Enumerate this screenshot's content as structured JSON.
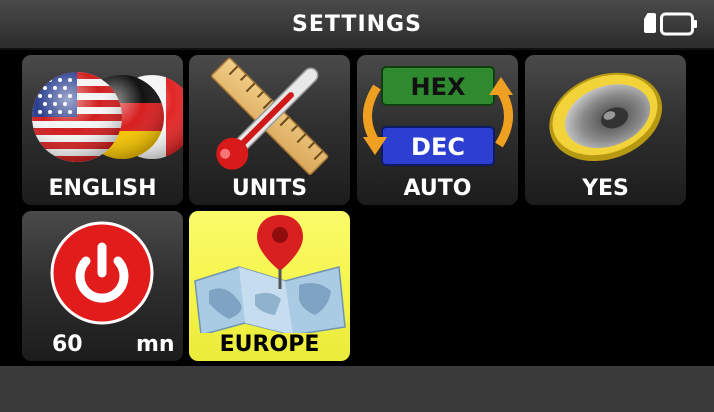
{
  "header": {
    "title": "SETTINGS",
    "status_icons": [
      "sd-card-icon",
      "battery-icon"
    ]
  },
  "tiles": [
    {
      "name": "language",
      "label": "ENGLISH",
      "icon": "flags-icon"
    },
    {
      "name": "units",
      "label": "UNITS",
      "icon": "ruler-thermometer-icon"
    },
    {
      "name": "hex-dec",
      "label": "AUTO",
      "icon": "hex-dec-icon",
      "icon_text": [
        "HEX",
        "DEC"
      ]
    },
    {
      "name": "sound",
      "label": "YES",
      "icon": "speaker-icon"
    },
    {
      "name": "auto-off",
      "value": "60",
      "unit": "mn",
      "icon": "power-icon"
    },
    {
      "name": "region",
      "label": "EUROPE",
      "icon": "map-pin-icon",
      "selected": true
    }
  ],
  "colors": {
    "header_bg": "#3a3a3a",
    "tile_bg": "#2e2e2e",
    "selected_bg": "#f3f34a",
    "power_red": "#e21b1b"
  }
}
